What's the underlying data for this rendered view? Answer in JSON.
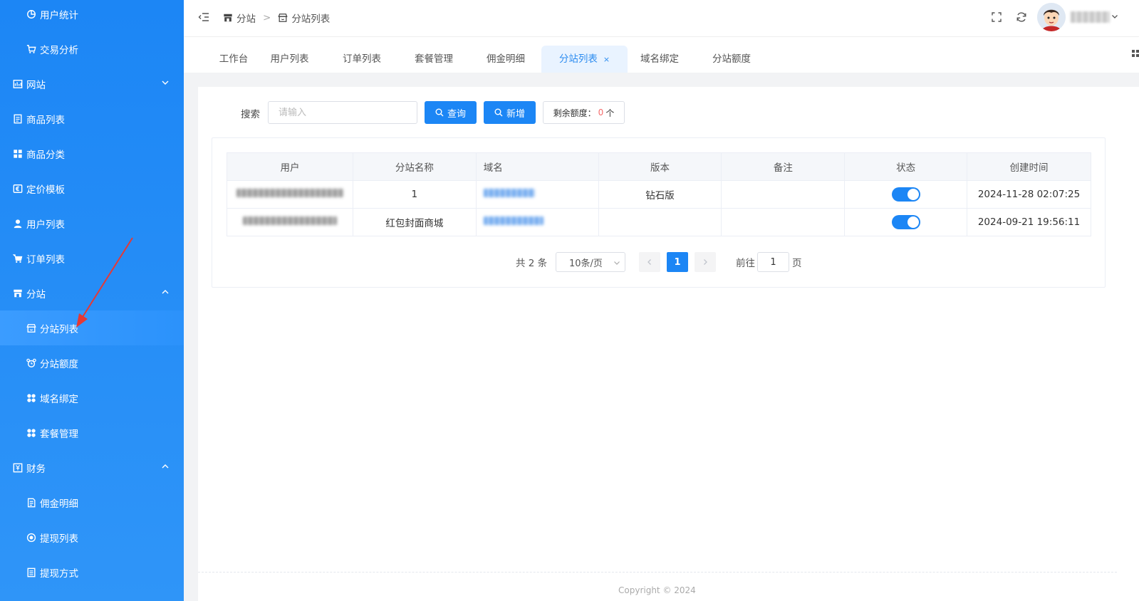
{
  "sidebar": {
    "items": [
      {
        "label": "用户统计",
        "icon": "pie-chart-icon",
        "level": 2
      },
      {
        "label": "交易分析",
        "icon": "cart-icon",
        "level": 2
      },
      {
        "label": "网站",
        "icon": "website-icon",
        "level": 1,
        "expanded": false
      },
      {
        "label": "商品列表",
        "icon": "list-icon",
        "level": 1
      },
      {
        "label": "商品分类",
        "icon": "grid-icon",
        "level": 1
      },
      {
        "label": "定价模板",
        "icon": "price-tag-icon",
        "level": 1
      },
      {
        "label": "用户列表",
        "icon": "user-icon",
        "level": 1
      },
      {
        "label": "订单列表",
        "icon": "cart-icon",
        "level": 1
      },
      {
        "label": "分站",
        "icon": "store-icon",
        "level": 1,
        "expanded": true
      },
      {
        "label": "分站列表",
        "icon": "shop-icon",
        "level": 2,
        "active": true
      },
      {
        "label": "分站额度",
        "icon": "alarm-icon",
        "level": 2
      },
      {
        "label": "域名绑定",
        "icon": "apps-icon",
        "level": 2
      },
      {
        "label": "套餐管理",
        "icon": "apps-icon",
        "level": 2
      },
      {
        "label": "财务",
        "icon": "finance-icon",
        "level": 1,
        "expanded": true
      },
      {
        "label": "佣金明细",
        "icon": "document-icon",
        "level": 2
      },
      {
        "label": "提现列表",
        "icon": "coin-icon",
        "level": 2
      },
      {
        "label": "提现方式",
        "icon": "document-icon",
        "level": 2
      }
    ]
  },
  "header": {
    "breadcrumb": [
      "分站",
      "分站列表"
    ],
    "breadcrumb_sep": ">"
  },
  "tabs": [
    {
      "label": "工作台"
    },
    {
      "label": "用户列表"
    },
    {
      "label": "订单列表"
    },
    {
      "label": "套餐管理"
    },
    {
      "label": "佣金明细"
    },
    {
      "label": "分站列表",
      "active": true,
      "close": "×"
    },
    {
      "label": "域名绑定"
    },
    {
      "label": "分站额度"
    }
  ],
  "search": {
    "label": "搜索",
    "placeholder": "请输入",
    "value": "",
    "query_button": "查询",
    "add_button": "新增",
    "quota_label": "剩余额度：",
    "quota_value": "0",
    "quota_unit": "个"
  },
  "table": {
    "columns": [
      "用户",
      "分站名称",
      "域名",
      "版本",
      "备注",
      "状态",
      "创建时间"
    ],
    "rows": [
      {
        "site_name": "1",
        "version": "钻石版",
        "remark": "",
        "status_on": true,
        "created": "2024-11-28 02:07:25"
      },
      {
        "site_name": "红包封面商城",
        "version": "",
        "remark": "",
        "status_on": true,
        "created": "2024-09-21 19:56:11"
      }
    ]
  },
  "pagination": {
    "total_text": "共 2 条",
    "page_size": "10条/页",
    "current_page": "1",
    "goto_label": "前往",
    "goto_value": "1",
    "page_unit": "页"
  },
  "footer": {
    "text": "Copyright © 2024"
  },
  "colors": {
    "sidebar": "#1c86f5",
    "primary": "#1c86f5",
    "quota_highlight": "#f56c6c",
    "annotation_arrow": "#e53935"
  }
}
